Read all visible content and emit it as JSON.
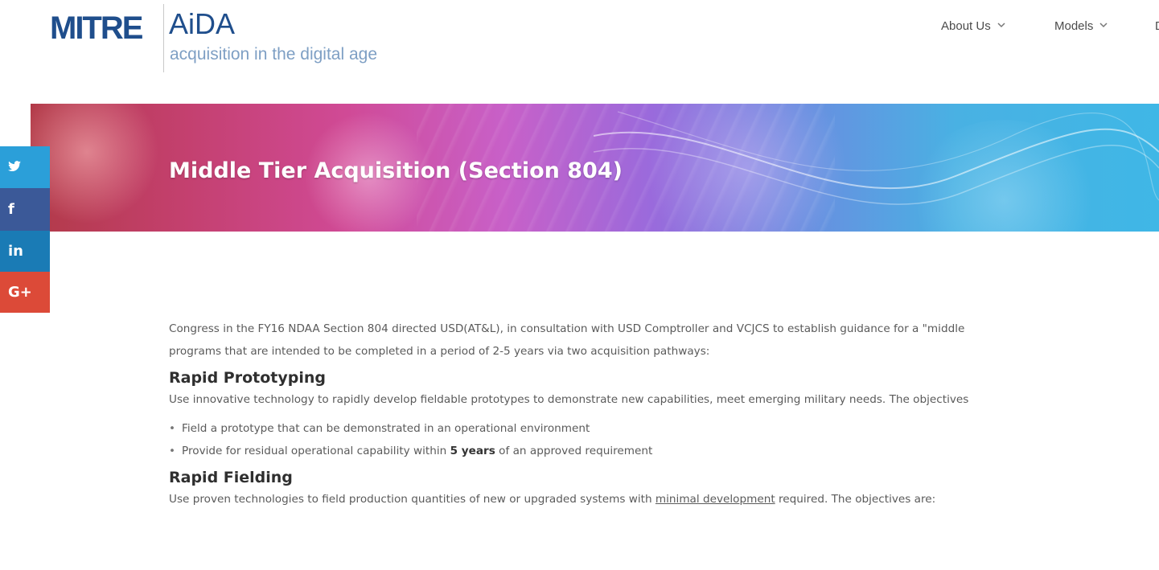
{
  "header": {
    "logo_mitre": "MITRE",
    "logo_aida": "AiDA",
    "tagline": "acquisition in the digital age",
    "nav": [
      {
        "label": "About Us",
        "icon": "chevron-down-icon"
      },
      {
        "label": "Models",
        "icon": "chevron-down-icon"
      },
      {
        "label": "D"
      }
    ]
  },
  "hero": {
    "title": "Middle Tier Acquisition (Section 804)"
  },
  "social": {
    "twitter": "t",
    "facebook": "f",
    "linkedin": "in",
    "gplus": "G+",
    "colors": {
      "twitter": "#2b9fd9",
      "facebook": "#3b5998",
      "linkedin": "#1a7bb5",
      "gplus": "#dc4a38"
    }
  },
  "content": {
    "intro_line1": "Congress in the FY16 NDAA Section 804 directed USD(AT&L), in consultation with USD Comptroller and VCJCS to establish guidance for a \"middle",
    "intro_line2": "programs that are intended to be completed in a period of 2-5 years via two acquisition pathways:",
    "sections": [
      {
        "heading": "Rapid Prototyping",
        "desc": "Use innovative technology to rapidly develop fieldable prototypes to demonstrate new capabilities, meet emerging military needs. The objectives",
        "bullets": [
          {
            "text": "Field a prototype that can be demonstrated in an operational environment"
          },
          {
            "pre": "Provide for residual operational capability within ",
            "bold": "5 years",
            "post": " of an approved requirement"
          }
        ]
      },
      {
        "heading": "Rapid Fielding",
        "desc_pre": "Use proven technologies to field production quantities of new or upgraded systems with ",
        "desc_link": "minimal development",
        "desc_post": " required. The objectives are:"
      }
    ]
  }
}
